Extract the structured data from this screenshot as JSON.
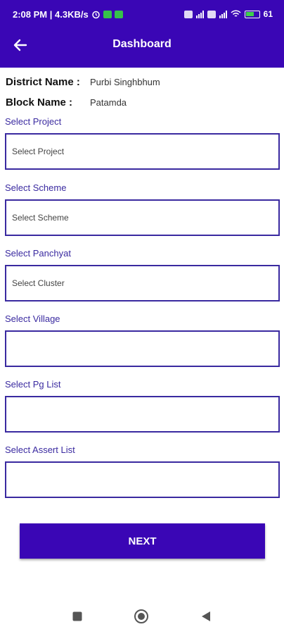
{
  "status_bar": {
    "time_speed": "2:08 PM | 4.3KB/s",
    "battery": "61"
  },
  "header": {
    "title": "Dashboard",
    "back_icon": "arrow-left-icon",
    "background": "#3a06b5"
  },
  "info": {
    "district_label": "District Name :",
    "district_value": "Purbi Singhbhum",
    "block_label": "Block Name :",
    "block_value": "Patamda"
  },
  "form": {
    "project": {
      "label": "Select Project",
      "value": "Select Project"
    },
    "scheme": {
      "label": "Select Scheme",
      "value": "Select Scheme"
    },
    "panchyat": {
      "label": "Select Panchyat",
      "value": "Select Cluster"
    },
    "village": {
      "label": "Select Village",
      "value": ""
    },
    "pg_list": {
      "label": "Select Pg List",
      "value": ""
    },
    "assert_list": {
      "label": "Select Assert List",
      "value": ""
    }
  },
  "next_button": {
    "label": "NEXT"
  },
  "nav": {
    "recents": "square-icon",
    "home": "circle-icon",
    "back": "triangle-back-icon"
  }
}
